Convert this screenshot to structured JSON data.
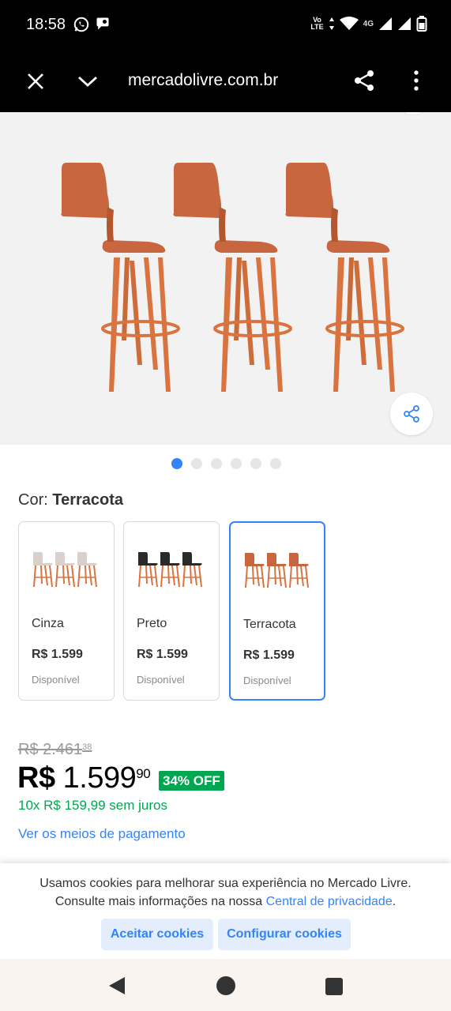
{
  "status_bar": {
    "time": "18:58",
    "left_icons": [
      "whatsapp-icon",
      "chat-bubble-icon"
    ],
    "right_icons": [
      "volte-icon",
      "data-arrows-icon",
      "wifi-icon",
      "signal-icon",
      "signal-icon",
      "battery-icon"
    ],
    "volte_text": "Vo\nLTE",
    "network_text": "4G"
  },
  "browser": {
    "url": "mercadolivre.com.br",
    "icons": [
      "close-icon",
      "chevron-down-icon",
      "share-icon",
      "more-vert-icon"
    ]
  },
  "gallery": {
    "image": "three terracotta bar stools",
    "dots_total": 6,
    "active_dot": 0
  },
  "color_picker": {
    "label": "Cor:",
    "selected_value": "Terracota",
    "variants": [
      {
        "name": "Cinza",
        "price": "R$ 1.599",
        "stock": "Disponível",
        "seat_color": "#d9cfcb",
        "selected": false
      },
      {
        "name": "Preto",
        "price": "R$ 1.599",
        "stock": "Disponível",
        "seat_color": "#2a2a2a",
        "selected": false
      },
      {
        "name": "Terracota",
        "price": "R$ 1.599",
        "stock": "Disponível",
        "seat_color": "#c8663f",
        "selected": true
      }
    ]
  },
  "pricing": {
    "old_price_main": "R$ 2.461",
    "old_price_cents": "38",
    "currency": "R$",
    "price_main": "1.599",
    "price_cents": "90",
    "discount": "34% OFF",
    "installments": "10x R$ 159,99 sem juros",
    "payment_link": "Ver os meios de pagamento"
  },
  "cookie_banner": {
    "line1": "Usamos cookies para melhorar sua experiência no Mercado Livre.",
    "line2_prefix": "Consulte mais informações na nossa ",
    "line2_link": "Central de privacidade",
    "line2_suffix": ".",
    "accept_label": "Aceitar cookies",
    "configure_label": "Configurar cookies"
  },
  "colors": {
    "accent": "#3483fa",
    "discount_green": "#00a650",
    "stool_wood": "#d9733f",
    "stool_seat": "#c8663f"
  }
}
